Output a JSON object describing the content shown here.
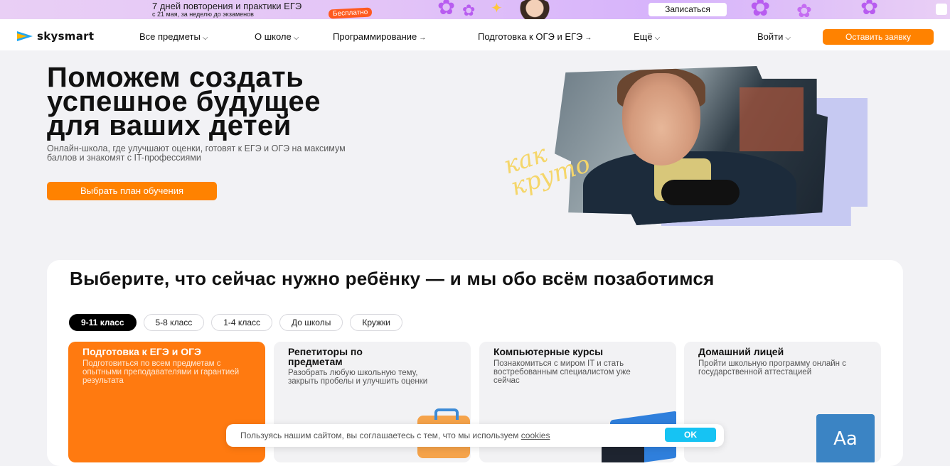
{
  "promo": {
    "title": "7 дней повторения и практики ЕГЭ",
    "subtitle": "с 21 мая, за неделю до экзаменов",
    "badge": "Бесплатно",
    "button": "Записаться"
  },
  "header": {
    "logo_text": "skysmart",
    "nav": [
      {
        "label": "Все предметы",
        "arrow": "⌵"
      },
      {
        "label": "О школе",
        "arrow": "⌵"
      },
      {
        "label": "Программирование",
        "arrow": "→"
      },
      {
        "label": "Подготовка к ОГЭ и ЕГЭ",
        "arrow": "→"
      },
      {
        "label": "Ещё",
        "arrow": "⌵"
      }
    ],
    "login": {
      "label": "Войти",
      "arrow": "⌵"
    },
    "cta": "Оставить заявку"
  },
  "hero": {
    "title_lines": [
      "Поможем создать",
      "успешное будущее",
      "для ваших детей"
    ],
    "subtitle": "Онлайн-школа, где улучшают оценки, готовят к ЕГЭ и ОГЭ на максимум баллов и знакомят с IT-профессиями",
    "button": "Выбрать план обучения",
    "scribble_lines": [
      "как",
      "круто"
    ]
  },
  "section": {
    "title": "Выберите, что сейчас нужно ребёнку — и мы обо всём позаботимся",
    "tabs": [
      "9-11 класс",
      "5-8 класс",
      "1-4 класс",
      "До школы",
      "Кружки"
    ],
    "active_tab": "9-11 класс",
    "cards": [
      {
        "title": "Подготовка к ЕГЭ и ОГЭ",
        "desc": "Подготовиться по всем предметам с опытными преподавателями и гарантией результата"
      },
      {
        "title": "Репетиторы по предметам",
        "desc": "Разобрать любую школьную тему, закрыть пробелы и улучшить оценки"
      },
      {
        "title": "Компьютерные курсы",
        "desc": "Познакомиться с миром IT и стать востребованным специалистом уже сейчас"
      },
      {
        "title": "Домашний лицей",
        "desc": "Пройти школьную программу онлайн с государственной аттестацией"
      }
    ],
    "book_icon_text": "Aa"
  },
  "cookie": {
    "text": "Пользуясь нашим сайтом, вы соглашаетесь с тем, что мы используем",
    "link": "cookies",
    "button": "OK"
  },
  "colors": {
    "accent": "#ff8200",
    "ok_button": "#16c3f3",
    "tab_active": "#000000"
  }
}
